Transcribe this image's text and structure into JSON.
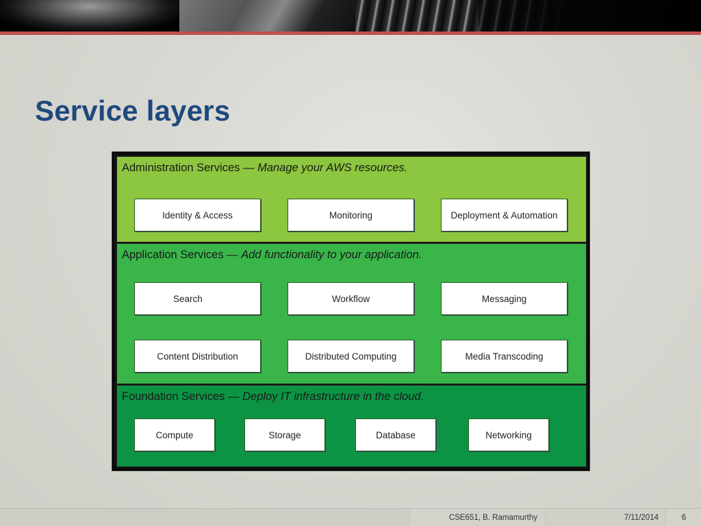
{
  "slide": {
    "title": "Service layers",
    "accent_color": "#c0504d",
    "title_color": "#1f497d"
  },
  "diagram": {
    "layers": [
      {
        "name": "Administration Services",
        "separator": " — ",
        "tagline": "Manage your AWS resources.",
        "color": "#8dc63f",
        "services": [
          "Identity & Access",
          "Monitoring",
          "Deployment & Automation"
        ]
      },
      {
        "name": "Application Services",
        "separator": " — ",
        "tagline": "Add functionality to your application.",
        "color": "#39b54a",
        "services": [
          "Search",
          "Workflow",
          "Messaging",
          "Content Distribution",
          "Distributed Computing",
          "Media Transcoding"
        ]
      },
      {
        "name": "Foundation Services",
        "separator": " — ",
        "tagline": "Deploy IT infrastructure in the cloud.",
        "color": "#0c9444",
        "services": [
          "Compute",
          "Storage",
          "Database",
          "Networking"
        ]
      }
    ]
  },
  "footer": {
    "author": "CSE651, B. Ramamurthy",
    "date": "7/11/2014",
    "page": "6"
  }
}
